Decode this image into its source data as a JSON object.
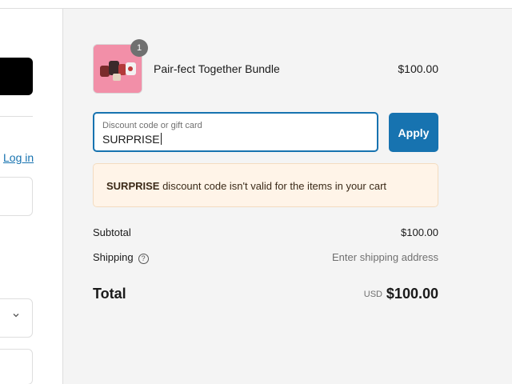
{
  "left_panel": {
    "login_link": "Log in"
  },
  "cart": {
    "items": [
      {
        "name": "Pair-fect Together Bundle",
        "price": "$100.00",
        "quantity": "1",
        "image": "product-thumbnail"
      }
    ]
  },
  "discount": {
    "label": "Discount code or gift card",
    "value": "SURPRISE",
    "apply_label": "Apply"
  },
  "error": {
    "code": "SURPRISE",
    "message": " discount code isn't valid for the items in your cart"
  },
  "totals": {
    "subtotal_label": "Subtotal",
    "subtotal_value": "$100.00",
    "shipping_label": "Shipping",
    "shipping_value": "Enter shipping address",
    "total_label": "Total",
    "currency": "USD",
    "total_value": "$100.00"
  },
  "colors": {
    "accent": "#1773b0",
    "summary_bg": "#f4f4f4",
    "error_bg": "#fff4e8",
    "thumb_bg": "#f28fa8"
  },
  "icons": {
    "info": "info-circle-icon",
    "chevron": "chevron-down-icon"
  }
}
